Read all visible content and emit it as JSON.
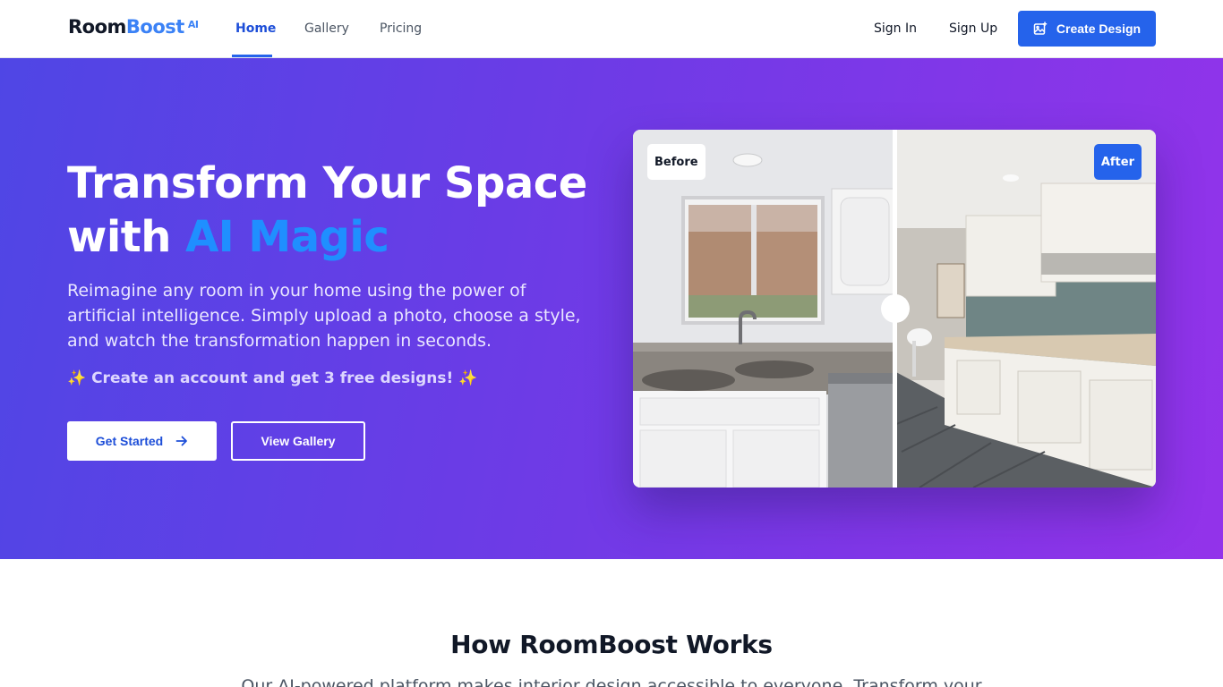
{
  "brand": {
    "room": "Room",
    "boost": "Boost",
    "ai": "AI"
  },
  "nav": {
    "links": [
      {
        "label": "Home",
        "active": true
      },
      {
        "label": "Gallery",
        "active": false
      },
      {
        "label": "Pricing",
        "active": false
      }
    ],
    "sign_in": "Sign In",
    "sign_up": "Sign Up",
    "create_design": "Create Design"
  },
  "hero": {
    "title_line1": "Transform Your Space",
    "title_with": "with ",
    "title_accent": "AI Magic",
    "subtitle": "Reimagine any room in your home using the power of artificial intelligence. Simply upload a photo, choose a style, and watch the transformation happen in seconds.",
    "promo": "✨ Create an account and get 3 free designs! ✨",
    "primary_button": "Get Started",
    "secondary_button": "View Gallery"
  },
  "comparison": {
    "before_label": "Before",
    "after_label": "After"
  },
  "how_it_works": {
    "title": "How RoomBoost Works",
    "subtitle": "Our AI-powered platform makes interior design accessible to everyone. Transform your"
  },
  "colors": {
    "accent": "#2563eb",
    "hero_start": "#4f46e5",
    "hero_end": "#9333ea"
  }
}
